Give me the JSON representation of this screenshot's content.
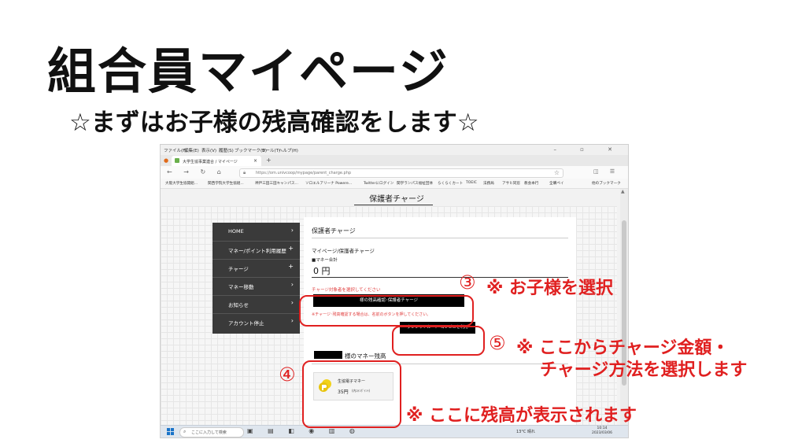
{
  "slide": {
    "title": "組合員マイページ",
    "subtitle": "☆まずはお子様の残高確認をします☆"
  },
  "browser": {
    "menu": [
      "ファイル(F)",
      "編集(E)",
      "表示(V)",
      "履歴(S)",
      "ブックマーク(B)",
      "ツール(T)",
      "ヘルプ(H)"
    ],
    "window_controls": "– ▫ ✕",
    "tab_label": "大学生協事業連合 / マイページ",
    "url": "https://om.univcoop/mypage/parent_charge.php",
    "bookmarks": [
      "大阪大学生協開組...",
      "関西学院大学生協組...",
      "神戸三田三田キャンパス...",
      "ソロエルアリーナ Powere...",
      "Twitterにログイン",
      "関学ランパス福祉団体",
      "らくらくカート",
      "TOEIC",
      "法務局",
      "アサヒ同窓",
      "教会本行",
      "全購ペイ",
      "他のブックマーク"
    ]
  },
  "page": {
    "heading": "保護者チャージ",
    "sidebar": [
      {
        "label": "HOME",
        "mark": "›"
      },
      {
        "label": "マネー/ポイント利用履歴",
        "mark": "+"
      },
      {
        "label": "チャージ",
        "mark": "+"
      },
      {
        "label": "マネー移動",
        "mark": "›"
      },
      {
        "label": "お知らせ",
        "mark": "›"
      },
      {
        "label": "アカウント停止",
        "mark": "›"
      }
    ],
    "card_title": "保護者チャージ",
    "breadcrumb": "マイページ/保護者チャージ",
    "money_total_label": "■マネー合計",
    "balance": "0 円",
    "select_hint": "チャージ対象者を選択してください",
    "child_select_button": "様の残高確認･保護者チャージ",
    "warning": "※チャージ･残高確認する場合は、名前のボタンを押してください。",
    "credit_button": "クレジットカード･コンビニを利用",
    "child_balance_heading": "様のマネー残高",
    "money_card": {
      "name": "生協電子マネー",
      "amount": "35円",
      "point": "(内ｺｲﾝﾎﾟｲﾝﾄ)"
    }
  },
  "taskbar": {
    "search_placeholder": "ここに入力して検索",
    "weather": "13°C 晴れ",
    "time": "10:14",
    "date": "2023/03/06"
  },
  "annotations": {
    "n3": "③",
    "note3": "※ お子様を選択",
    "n5": "⑤",
    "note5_line1": "※ ここからチャージ金額・",
    "note5_line2": "チャージ方法を選択します",
    "n4": "④",
    "note4": "※ ここに残高が表示されます"
  },
  "colors": {
    "annotation_red": "#e02020",
    "sidebar_bg": "#3a3a3a",
    "button_black": "#000000"
  }
}
